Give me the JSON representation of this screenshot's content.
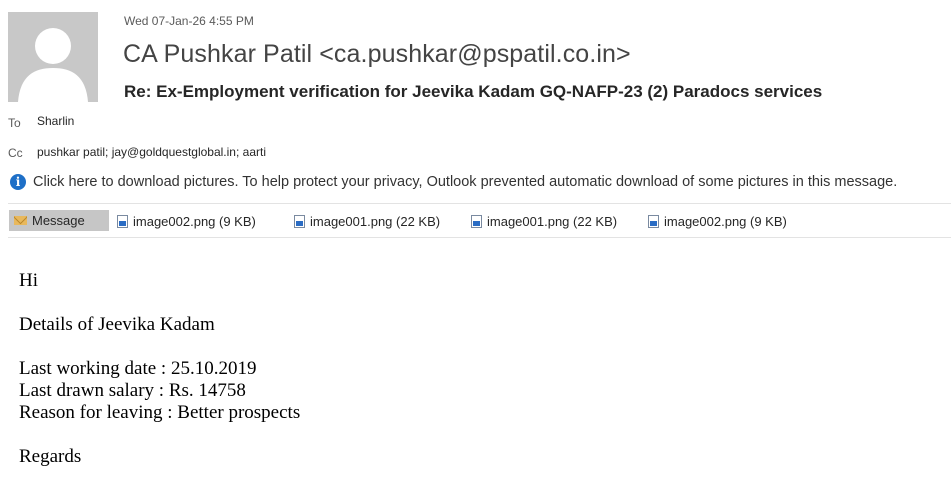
{
  "header": {
    "date": "Wed 07-Jan-26 4:55 PM",
    "sender": "CA Pushkar Patil <ca.pushkar@pspatil.co.in>",
    "subject": "Re: Ex-Employment verification for Jeevika Kadam GQ-NAFP-23 (2) Paradocs services",
    "to_label": "To",
    "to_value": "Sharlin",
    "cc_label": "Cc",
    "cc_value": "pushkar patil; jay@goldquestglobal.in; aarti",
    "avatar_icon": "person-silhouette-icon"
  },
  "infobar": {
    "icon": "info-icon",
    "text": "Click here to download pictures. To help protect your privacy, Outlook prevented automatic download of some pictures in this message."
  },
  "attachments": {
    "message_tab": "Message",
    "items": [
      "image002.png (9 KB)",
      "image001.png (22 KB)",
      "image001.png (22 KB)",
      "image002.png (9 KB)"
    ]
  },
  "body": {
    "greeting": "Hi",
    "details": "Details of Jeevika Kadam",
    "line1": "Last working date : 25.10.2019",
    "line2": "Last drawn salary : Rs. 14758",
    "line3": "Reason for leaving : Better prospects",
    "closing": "Regards"
  },
  "colors": {
    "info_blue": "#1e6fc7",
    "tab_gray": "#c6c6c6",
    "avatar_gray": "#c8c8c8"
  }
}
